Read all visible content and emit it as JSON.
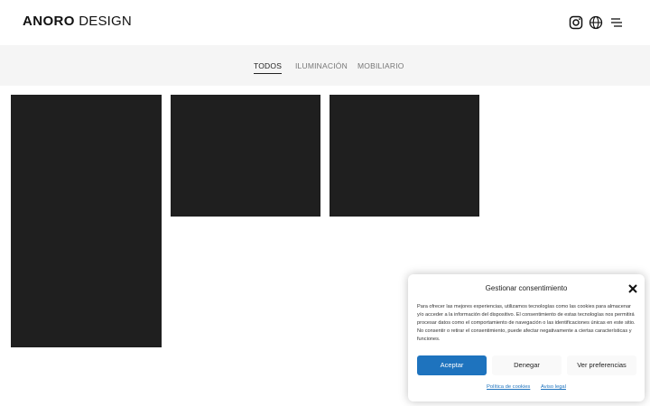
{
  "header": {
    "logo_bold": "ANORO",
    "logo_light": "DESIGN",
    "icons": [
      "instagram-icon",
      "globe-icon",
      "menu-icon"
    ]
  },
  "filters": {
    "tabs": [
      {
        "label": "TODOS",
        "active": true
      },
      {
        "label": "ILUMINACIÓN",
        "active": false
      },
      {
        "label": "MOBILIARIO",
        "active": false
      }
    ]
  },
  "gallery": {
    "tile_color": "#1f1f1f",
    "tile_count": 3
  },
  "consent": {
    "title": "Gestionar consentimiento",
    "body": "Para ofrecer las mejores experiencias, utilizamos tecnologías como las cookies para almacenar y/o acceder a la información del dispositivo. El consentimiento de estas tecnologías nos permitirá procesar datos como el comportamiento de navegación o las identificaciones únicas en este sitio. No consentir o retirar el consentimiento, puede afectar negativamente a ciertas características y funciones.",
    "accept_label": "Aceptar",
    "deny_label": "Denegar",
    "prefs_label": "Ver preferencias",
    "cookie_policy_label": "Política de cookies",
    "legal_label": "Aviso legal",
    "accent_color": "#1e73be"
  }
}
